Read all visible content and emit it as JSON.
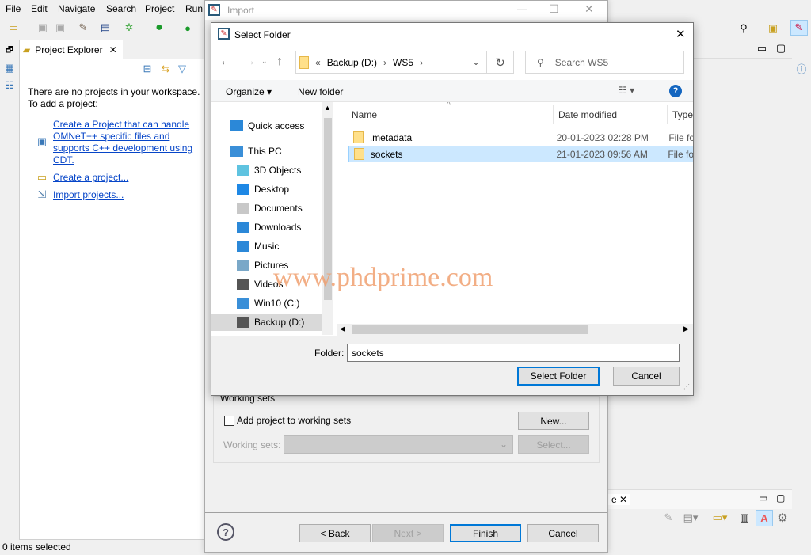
{
  "eclipse": {
    "menu": [
      "File",
      "Edit",
      "Navigate",
      "Search",
      "Project",
      "Run"
    ],
    "project_explorer": {
      "tab": "Project Explorer",
      "empty_line1": "There are no projects in your workspace.",
      "empty_line2": "To add a project:",
      "links": [
        "Create a Project that can handle OMNeT++ specific files and supports C++ development using CDT.",
        "Create a project...",
        "Import projects..."
      ]
    },
    "status": "0 items selected",
    "bottom_tab_fragment": "e"
  },
  "import_dialog": {
    "title": "Import",
    "working_sets": {
      "group_label": "Working sets",
      "checkbox_label": "Add project to working sets",
      "checked": false,
      "new_button": "New...",
      "field_label": "Working sets:",
      "field_value": "",
      "select_button": "Select..."
    },
    "buttons": {
      "back": "< Back",
      "next": "Next >",
      "finish": "Finish",
      "cancel": "Cancel"
    }
  },
  "select_folder": {
    "title": "Select Folder",
    "address": {
      "prefix": "«",
      "crumbs": [
        "Backup (D:)",
        "WS5"
      ]
    },
    "search_placeholder": "Search WS5",
    "toolbar": {
      "organize": "Organize",
      "new_folder": "New folder"
    },
    "nav": [
      {
        "label": "Quick access",
        "icon": "star-icon",
        "color": "#2b88d8"
      },
      {
        "label": "This PC",
        "icon": "computer-icon",
        "color": "#3a8fd8"
      },
      {
        "label": "3D Objects",
        "icon": "cube-icon",
        "color": "#5fc3e0"
      },
      {
        "label": "Desktop",
        "icon": "desktop-icon",
        "color": "#1e88e5"
      },
      {
        "label": "Documents",
        "icon": "document-icon",
        "color": "#c8c8c8"
      },
      {
        "label": "Downloads",
        "icon": "download-icon",
        "color": "#2b88d8"
      },
      {
        "label": "Music",
        "icon": "music-icon",
        "color": "#2b88d8"
      },
      {
        "label": "Pictures",
        "icon": "pictures-icon",
        "color": "#7aa8c8"
      },
      {
        "label": "Videos",
        "icon": "video-icon",
        "color": "#555555"
      },
      {
        "label": "Win10 (C:)",
        "icon": "drive-icon",
        "color": "#3a8fd8"
      },
      {
        "label": "Backup (D:)",
        "icon": "drive-icon",
        "color": "#555555",
        "selected": true
      }
    ],
    "columns": [
      "Name",
      "Date modified",
      "Type"
    ],
    "files": [
      {
        "name": ".metadata",
        "date": "20-01-2023 02:28 PM",
        "type": "File fo"
      },
      {
        "name": "sockets",
        "date": "21-01-2023 09:56 AM",
        "type": "File fo",
        "selected": true
      }
    ],
    "folder_label": "Folder:",
    "folder_value": "sockets",
    "buttons": {
      "select": "Select Folder",
      "cancel": "Cancel"
    }
  },
  "watermark": "www.phdprime.com",
  "colors": {
    "selection": "#cce8ff",
    "link": "#0645c8",
    "accent": "#0078d7",
    "watermark": "#f0a070"
  }
}
